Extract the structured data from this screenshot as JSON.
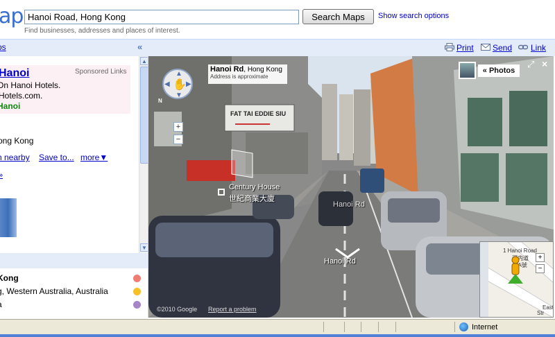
{
  "app": {
    "logo_fragment": "aps",
    "search_value": "Hanoi Road, Hong Kong",
    "search_button": "Search Maps",
    "search_options": "Show search options",
    "search_hint": "Find businesses, addresses and places of interest."
  },
  "strip": {
    "left_link": "ps",
    "collapse": "«",
    "actions": [
      {
        "label": "Print",
        "icon": "printer-icon"
      },
      {
        "label": "Send",
        "icon": "envelope-icon"
      },
      {
        "label": "Link",
        "icon": "chain-link-icon"
      }
    ]
  },
  "left_panel": {
    "ad": {
      "title": "Hanoi",
      "sponsored": "Sponsored Links",
      "line1": "On Hanoi Hotels.",
      "line2": "Hotels.com.",
      "line3": "Hanoi"
    },
    "place_text": "ong Kong",
    "actions": {
      "nearby": "h nearby",
      "save": "Save to...",
      "more": "more▼"
    },
    "small_link": "»",
    "results": [
      {
        "text": "Kong",
        "bold": true,
        "dot_color": "#f07d73"
      },
      {
        "text": "g, Western Australia, Australia",
        "bold": false,
        "dot_color": "#f6c026"
      },
      {
        "text": "a",
        "bold": false,
        "dot_color": "#a785c9"
      }
    ]
  },
  "street_view": {
    "title": "Hanoi Rd",
    "title_city": ", Hong Kong",
    "approx": "Address is approximate",
    "photos_button": "« Photos",
    "sign_text": "FAT TAI EDDIE SIU",
    "poi_name": "Century House",
    "poi_name_cn": "世紀商業大廈",
    "road_label_1": "Hanoi Rd",
    "road_label_2": "Hanoi Rd",
    "compass": "N",
    "zoom_in": "+",
    "zoom_out": "−",
    "copyright": "©2010 Google",
    "report": "Report a problem"
  },
  "inset_map": {
    "label1": "1 Hanoi Road",
    "label2": "河内道",
    "label3": "1A號",
    "label4": "East",
    "label5": "Str",
    "zoom_in": "+",
    "zoom_out": "−"
  },
  "status_bar": {
    "zone": "Internet"
  }
}
